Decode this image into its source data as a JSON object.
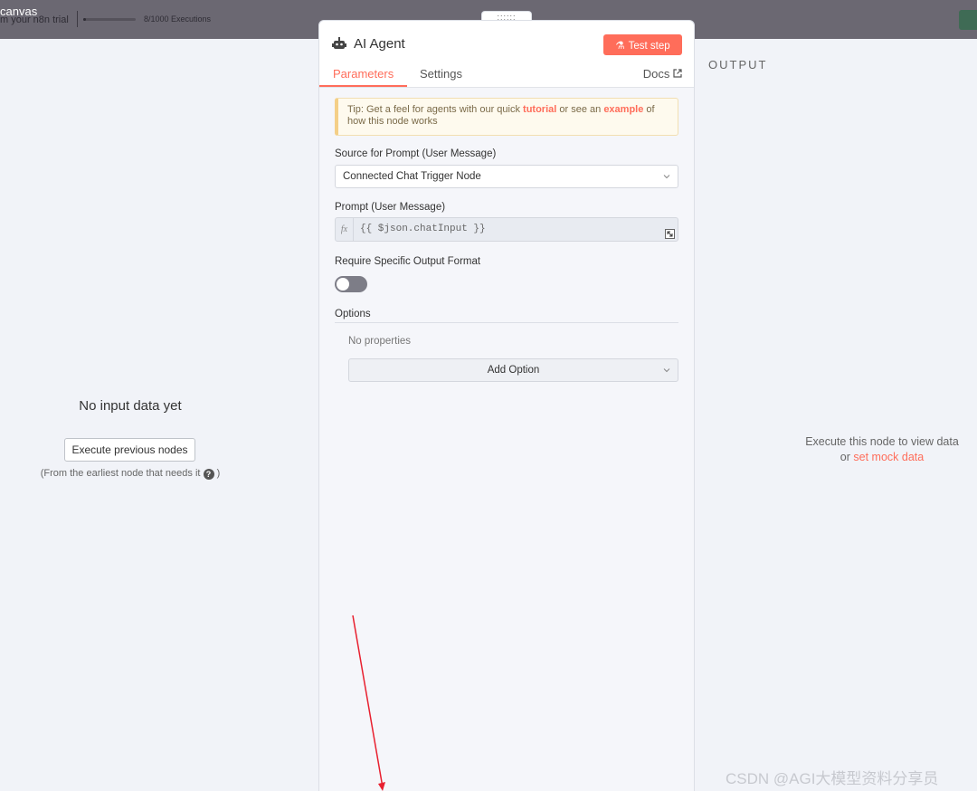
{
  "topbar": {
    "title": "canvas",
    "trial": "m your n8n trial",
    "executions": "8/1000 Executions",
    "execution_progress": 0.008
  },
  "input_pane": {
    "title": "No input data yet",
    "execute_button": "Execute previous nodes",
    "hint": "(From the earliest node that needs it",
    "hint_close": ")"
  },
  "output_pane": {
    "label": "OUTPUT",
    "message": "Execute this node to view data",
    "or": "or",
    "mock_link": "set mock data"
  },
  "panel": {
    "drag_handle": "::::::",
    "node_name": "AI Agent",
    "test_step": "Test step",
    "tabs": [
      {
        "label": "Parameters",
        "active": true
      },
      {
        "label": "Settings",
        "active": false
      }
    ],
    "docs": "Docs",
    "tip": {
      "part1": "Tip: Get a feel for agents with our quick",
      "tutorial": "tutorial",
      "part2": "or see an",
      "example": "example",
      "part3": "of how this node works"
    },
    "source_label": "Source for Prompt (User Message)",
    "source_value": "Connected Chat Trigger Node",
    "prompt_label": "Prompt (User Message)",
    "prompt_fx": "fx",
    "prompt_value": "{{ $json.chatInput }}",
    "output_format_label": "Require Specific Output Format",
    "output_format_enabled": false,
    "options_label": "Options",
    "no_properties": "No properties",
    "add_option": "Add Option"
  },
  "colors": {
    "accent": "#ff6d5a",
    "annotation_arrow": "#e8202f"
  },
  "watermark": "CSDN @AGI大模型资料分享员"
}
